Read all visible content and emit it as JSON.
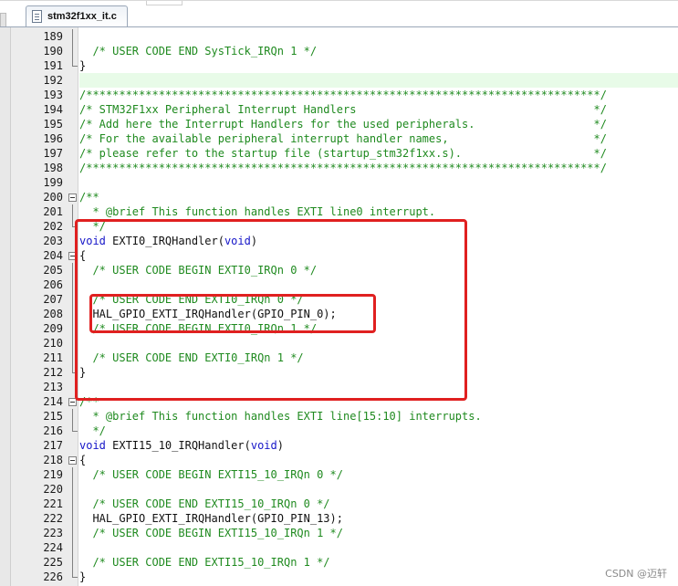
{
  "editor": {
    "tab": {
      "filename": "stm32f1xx_it.c",
      "icon": "c-file-icon"
    }
  },
  "colors": {
    "comment": "#1f8a1f",
    "keyword": "#1515c8",
    "annotation": "#e02020",
    "current_line": "#e8fbe8"
  },
  "lines": [
    {
      "num": "189",
      "fold": "vline",
      "tokens": []
    },
    {
      "num": "190",
      "fold": "vline",
      "tokens": [
        {
          "t": "c",
          "v": "  /* USER CODE END SysTick_IRQn 1 */"
        }
      ]
    },
    {
      "num": "191",
      "fold": "end",
      "tokens": [
        {
          "t": "p",
          "v": "}"
        }
      ]
    },
    {
      "num": "192",
      "fold": "none",
      "current": true,
      "tokens": []
    },
    {
      "num": "193",
      "fold": "none",
      "tokens": [
        {
          "t": "c",
          "v": "/******************************************************************************/"
        }
      ]
    },
    {
      "num": "194",
      "fold": "none",
      "tokens": [
        {
          "t": "c",
          "v": "/* STM32F1xx Peripheral Interrupt Handlers                                    */"
        }
      ]
    },
    {
      "num": "195",
      "fold": "none",
      "tokens": [
        {
          "t": "c",
          "v": "/* Add here the Interrupt Handlers for the used peripherals.                  */"
        }
      ]
    },
    {
      "num": "196",
      "fold": "none",
      "tokens": [
        {
          "t": "c",
          "v": "/* For the available peripheral interrupt handler names,                      */"
        }
      ]
    },
    {
      "num": "197",
      "fold": "none",
      "tokens": [
        {
          "t": "c",
          "v": "/* please refer to the startup file (startup_stm32f1xx.s).                    */"
        }
      ]
    },
    {
      "num": "198",
      "fold": "none",
      "tokens": [
        {
          "t": "c",
          "v": "/******************************************************************************/"
        }
      ]
    },
    {
      "num": "199",
      "fold": "none",
      "tokens": []
    },
    {
      "num": "200",
      "fold": "box",
      "tokens": [
        {
          "t": "c",
          "v": "/**"
        }
      ]
    },
    {
      "num": "201",
      "fold": "vline",
      "tokens": [
        {
          "t": "c",
          "v": "  * @brief This function handles EXTI line0 interrupt."
        }
      ]
    },
    {
      "num": "202",
      "fold": "end",
      "tokens": [
        {
          "t": "c",
          "v": "  */"
        }
      ]
    },
    {
      "num": "203",
      "fold": "none",
      "tokens": [
        {
          "t": "k",
          "v": "void"
        },
        {
          "t": "p",
          "v": " EXTI0_IRQHandler("
        },
        {
          "t": "k",
          "v": "void"
        },
        {
          "t": "p",
          "v": ")"
        }
      ]
    },
    {
      "num": "204",
      "fold": "box",
      "tokens": [
        {
          "t": "p",
          "v": "{"
        }
      ]
    },
    {
      "num": "205",
      "fold": "vline",
      "tokens": [
        {
          "t": "c",
          "v": "  /* USER CODE BEGIN EXTI0_IRQn 0 */"
        }
      ]
    },
    {
      "num": "206",
      "fold": "vline",
      "tokens": []
    },
    {
      "num": "207",
      "fold": "vline",
      "tokens": [
        {
          "t": "c",
          "v": "  /* USER CODE END EXTI0_IRQn 0 */"
        }
      ]
    },
    {
      "num": "208",
      "fold": "vline",
      "tokens": [
        {
          "t": "p",
          "v": "  HAL_GPIO_EXTI_IRQHandler(GPIO_PIN_0);"
        }
      ]
    },
    {
      "num": "209",
      "fold": "vline",
      "tokens": [
        {
          "t": "c",
          "v": "  /* USER CODE BEGIN EXTI0_IRQn 1 */"
        }
      ]
    },
    {
      "num": "210",
      "fold": "vline",
      "tokens": []
    },
    {
      "num": "211",
      "fold": "vline",
      "tokens": [
        {
          "t": "c",
          "v": "  /* USER CODE END EXTI0_IRQn 1 */"
        }
      ]
    },
    {
      "num": "212",
      "fold": "end",
      "tokens": [
        {
          "t": "p",
          "v": "}"
        }
      ]
    },
    {
      "num": "213",
      "fold": "none",
      "tokens": []
    },
    {
      "num": "214",
      "fold": "box",
      "tokens": [
        {
          "t": "c",
          "v": "/**"
        }
      ]
    },
    {
      "num": "215",
      "fold": "vline",
      "tokens": [
        {
          "t": "c",
          "v": "  * @brief This function handles EXTI line[15:10] interrupts."
        }
      ]
    },
    {
      "num": "216",
      "fold": "end",
      "tokens": [
        {
          "t": "c",
          "v": "  */"
        }
      ]
    },
    {
      "num": "217",
      "fold": "none",
      "tokens": [
        {
          "t": "k",
          "v": "void"
        },
        {
          "t": "p",
          "v": " EXTI15_10_IRQHandler("
        },
        {
          "t": "k",
          "v": "void"
        },
        {
          "t": "p",
          "v": ")"
        }
      ]
    },
    {
      "num": "218",
      "fold": "box",
      "tokens": [
        {
          "t": "p",
          "v": "{"
        }
      ]
    },
    {
      "num": "219",
      "fold": "vline",
      "tokens": [
        {
          "t": "c",
          "v": "  /* USER CODE BEGIN EXTI15_10_IRQn 0 */"
        }
      ]
    },
    {
      "num": "220",
      "fold": "vline",
      "tokens": []
    },
    {
      "num": "221",
      "fold": "vline",
      "tokens": [
        {
          "t": "c",
          "v": "  /* USER CODE END EXTI15_10_IRQn 0 */"
        }
      ]
    },
    {
      "num": "222",
      "fold": "vline",
      "tokens": [
        {
          "t": "p",
          "v": "  HAL_GPIO_EXTI_IRQHandler(GPIO_PIN_13);"
        }
      ]
    },
    {
      "num": "223",
      "fold": "vline",
      "tokens": [
        {
          "t": "c",
          "v": "  /* USER CODE BEGIN EXTI15_10_IRQn 1 */"
        }
      ]
    },
    {
      "num": "224",
      "fold": "vline",
      "tokens": []
    },
    {
      "num": "225",
      "fold": "vline",
      "tokens": [
        {
          "t": "c",
          "v": "  /* USER CODE END EXTI15_10_IRQn 1 */"
        }
      ]
    },
    {
      "num": "226",
      "fold": "end",
      "tokens": [
        {
          "t": "p",
          "v": "}"
        }
      ]
    }
  ],
  "watermark": "CSDN @迈轩"
}
